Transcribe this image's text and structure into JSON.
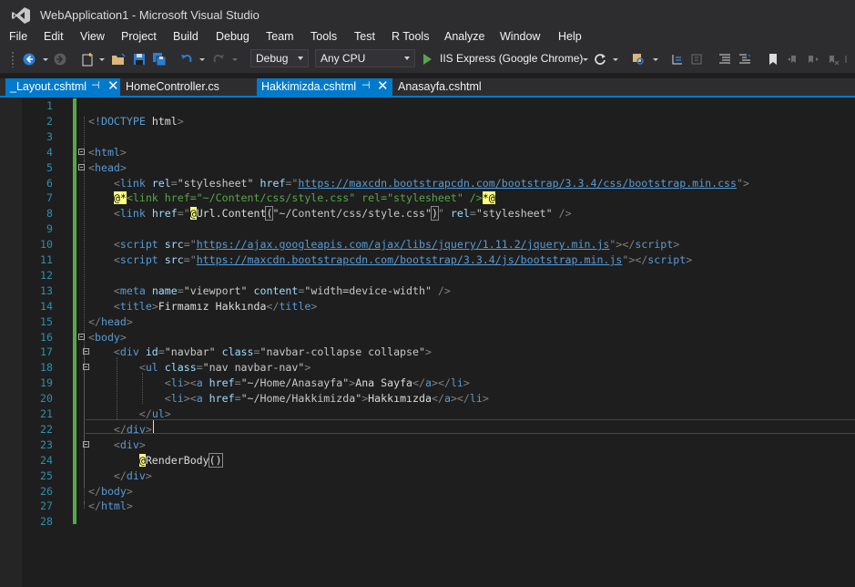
{
  "window": {
    "title": "WebApplication1 - Microsoft Visual Studio"
  },
  "menu": [
    "File",
    "Edit",
    "View",
    "Project",
    "Build",
    "Debug",
    "Team",
    "Tools",
    "Test",
    "R Tools",
    "Analyze",
    "Window",
    "Help"
  ],
  "toolbar": {
    "configuration": "Debug",
    "platform": "Any CPU",
    "start_target": "IIS Express (Google Chrome)"
  },
  "tabs": [
    {
      "label": "_Layout.cshtml",
      "active": true,
      "pinned": true
    },
    {
      "label": "HomeController.cs",
      "active": false,
      "pinned": false
    },
    {
      "label": "Hakkimizda.cshtml",
      "active": true,
      "pinned": true
    },
    {
      "label": "Anasayfa.cshtml",
      "active": false,
      "pinned": false
    }
  ],
  "editor": {
    "current_line": 22,
    "lines": [
      {
        "n": "1",
        "indent": "",
        "tokens": []
      },
      {
        "n": "2",
        "indent": "",
        "tokens": [
          [
            "t-punc",
            "<"
          ],
          [
            "t-tag",
            "!DOCTYPE "
          ],
          [
            "t-text",
            "html"
          ],
          [
            "t-punc",
            ">"
          ]
        ]
      },
      {
        "n": "3",
        "indent": "",
        "tokens": []
      },
      {
        "n": "4",
        "indent": "",
        "fold": true,
        "tokens": [
          [
            "t-punc",
            "<"
          ],
          [
            "t-tag",
            "html"
          ],
          [
            "t-punc",
            ">"
          ]
        ]
      },
      {
        "n": "5",
        "indent": "",
        "fold": true,
        "tokens": [
          [
            "t-punc",
            "<"
          ],
          [
            "t-tag",
            "head"
          ],
          [
            "t-punc",
            ">"
          ]
        ]
      },
      {
        "n": "6",
        "indent": "    ",
        "tokens": [
          [
            "t-punc",
            "<"
          ],
          [
            "t-tag",
            "link "
          ],
          [
            "t-attr",
            "rel"
          ],
          [
            "t-punc",
            "="
          ],
          [
            "t-str",
            "\"stylesheet\" "
          ],
          [
            "t-attr",
            "href"
          ],
          [
            "t-punc",
            "=\""
          ],
          [
            "t-url",
            "https://maxcdn.bootstrapcdn.com/bootstrap/3.3.4/css/bootstrap.min.css"
          ],
          [
            "t-punc",
            "\">"
          ]
        ]
      },
      {
        "n": "7",
        "indent": "    ",
        "tokens": [
          [
            "t-razor",
            "@*"
          ],
          [
            "t-comment",
            "<link href=\"~/Content/css/style.css\" rel=\"stylesheet\" />"
          ],
          [
            "t-razor",
            "*@"
          ]
        ]
      },
      {
        "n": "8",
        "indent": "    ",
        "tokens": [
          [
            "t-punc",
            "<"
          ],
          [
            "t-tag",
            "link "
          ],
          [
            "t-attr",
            "href"
          ],
          [
            "t-punc",
            "=\""
          ],
          [
            "t-razor",
            "@"
          ],
          [
            "t-method",
            "Url.Content"
          ],
          [
            "t-brace",
            "("
          ],
          [
            "t-str",
            "\"~/Content/css/style.css\""
          ],
          [
            "t-brace",
            ")"
          ],
          [
            "t-punc",
            "\" "
          ],
          [
            "t-attr",
            "rel"
          ],
          [
            "t-punc",
            "="
          ],
          [
            "t-str",
            "\"stylesheet\" "
          ],
          [
            "t-punc",
            "/>"
          ]
        ]
      },
      {
        "n": "9",
        "indent": "",
        "tokens": []
      },
      {
        "n": "10",
        "indent": "    ",
        "tokens": [
          [
            "t-punc",
            "<"
          ],
          [
            "t-tag",
            "script "
          ],
          [
            "t-attr",
            "src"
          ],
          [
            "t-punc",
            "=\""
          ],
          [
            "t-url",
            "https://ajax.googleapis.com/ajax/libs/jquery/1.11.2/jquery.min.js"
          ],
          [
            "t-punc",
            "\"></"
          ],
          [
            "t-tag",
            "script"
          ],
          [
            "t-punc",
            ">"
          ]
        ]
      },
      {
        "n": "11",
        "indent": "    ",
        "tokens": [
          [
            "t-punc",
            "<"
          ],
          [
            "t-tag",
            "script "
          ],
          [
            "t-attr",
            "src"
          ],
          [
            "t-punc",
            "=\""
          ],
          [
            "t-url",
            "https://maxcdn.bootstrapcdn.com/bootstrap/3.3.4/js/bootstrap.min.js"
          ],
          [
            "t-punc",
            "\"></"
          ],
          [
            "t-tag",
            "script"
          ],
          [
            "t-punc",
            ">"
          ]
        ]
      },
      {
        "n": "12",
        "indent": "",
        "tokens": []
      },
      {
        "n": "13",
        "indent": "    ",
        "tokens": [
          [
            "t-punc",
            "<"
          ],
          [
            "t-tag",
            "meta "
          ],
          [
            "t-attr",
            "name"
          ],
          [
            "t-punc",
            "="
          ],
          [
            "t-str",
            "\"viewport\" "
          ],
          [
            "t-attr",
            "content"
          ],
          [
            "t-punc",
            "="
          ],
          [
            "t-str",
            "\"width=device-width\" "
          ],
          [
            "t-punc",
            "/>"
          ]
        ]
      },
      {
        "n": "14",
        "indent": "    ",
        "tokens": [
          [
            "t-punc",
            "<"
          ],
          [
            "t-tag",
            "title"
          ],
          [
            "t-punc",
            ">"
          ],
          [
            "t-text",
            "Firmamız Hakkında"
          ],
          [
            "t-punc",
            "</"
          ],
          [
            "t-tag",
            "title"
          ],
          [
            "t-punc",
            ">"
          ]
        ]
      },
      {
        "n": "15",
        "indent": "",
        "tokens": [
          [
            "t-punc",
            "</"
          ],
          [
            "t-tag",
            "head"
          ],
          [
            "t-punc",
            ">"
          ]
        ]
      },
      {
        "n": "16",
        "indent": "",
        "fold": true,
        "tokens": [
          [
            "t-punc",
            "<"
          ],
          [
            "t-tag",
            "body"
          ],
          [
            "t-punc",
            ">"
          ]
        ]
      },
      {
        "n": "17",
        "indent": "    ",
        "fold": true,
        "tokens": [
          [
            "t-punc",
            "<"
          ],
          [
            "t-tag",
            "div "
          ],
          [
            "t-attr",
            "id"
          ],
          [
            "t-punc",
            "="
          ],
          [
            "t-str",
            "\"navbar\" "
          ],
          [
            "t-attr",
            "class"
          ],
          [
            "t-punc",
            "="
          ],
          [
            "t-str",
            "\"navbar-collapse collapse\""
          ],
          [
            "t-punc",
            ">"
          ]
        ]
      },
      {
        "n": "18",
        "indent": "        ",
        "fold": true,
        "tokens": [
          [
            "t-punc",
            "<"
          ],
          [
            "t-tag",
            "ul "
          ],
          [
            "t-attr",
            "class"
          ],
          [
            "t-punc",
            "="
          ],
          [
            "t-str",
            "\"nav navbar-nav\""
          ],
          [
            "t-punc",
            ">"
          ]
        ]
      },
      {
        "n": "19",
        "indent": "            ",
        "tokens": [
          [
            "t-punc",
            "<"
          ],
          [
            "t-tag",
            "li"
          ],
          [
            "t-punc",
            "><"
          ],
          [
            "t-tag",
            "a "
          ],
          [
            "t-attr",
            "href"
          ],
          [
            "t-punc",
            "="
          ],
          [
            "t-str",
            "\"~/Home/Anasayfa\""
          ],
          [
            "t-punc",
            ">"
          ],
          [
            "t-text",
            "Ana Sayfa"
          ],
          [
            "t-punc",
            "</"
          ],
          [
            "t-tag",
            "a"
          ],
          [
            "t-punc",
            "></"
          ],
          [
            "t-tag",
            "li"
          ],
          [
            "t-punc",
            ">"
          ]
        ]
      },
      {
        "n": "20",
        "indent": "            ",
        "tokens": [
          [
            "t-punc",
            "<"
          ],
          [
            "t-tag",
            "li"
          ],
          [
            "t-punc",
            "><"
          ],
          [
            "t-tag",
            "a "
          ],
          [
            "t-attr",
            "href"
          ],
          [
            "t-punc",
            "="
          ],
          [
            "t-str",
            "\"~/Home/Hakkimizda\""
          ],
          [
            "t-punc",
            ">"
          ],
          [
            "t-text",
            "Hakkımızda"
          ],
          [
            "t-punc",
            "</"
          ],
          [
            "t-tag",
            "a"
          ],
          [
            "t-punc",
            "></"
          ],
          [
            "t-tag",
            "li"
          ],
          [
            "t-punc",
            ">"
          ]
        ]
      },
      {
        "n": "21",
        "indent": "        ",
        "tokens": [
          [
            "t-punc",
            "</"
          ],
          [
            "t-tag",
            "ul"
          ],
          [
            "t-punc",
            ">"
          ]
        ]
      },
      {
        "n": "22",
        "indent": "    ",
        "tokens": [
          [
            "t-punc",
            "</"
          ],
          [
            "t-tag",
            "div"
          ],
          [
            "t-punc",
            ">"
          ]
        ]
      },
      {
        "n": "23",
        "indent": "    ",
        "fold": true,
        "tokens": [
          [
            "t-punc",
            "<"
          ],
          [
            "t-tag",
            "div"
          ],
          [
            "t-punc",
            ">"
          ]
        ]
      },
      {
        "n": "24",
        "indent": "        ",
        "tokens": [
          [
            "t-razor",
            "@"
          ],
          [
            "t-method",
            "RenderBody"
          ],
          [
            "t-brace",
            "()"
          ]
        ]
      },
      {
        "n": "25",
        "indent": "    ",
        "tokens": [
          [
            "t-punc",
            "</"
          ],
          [
            "t-tag",
            "div"
          ],
          [
            "t-punc",
            ">"
          ]
        ]
      },
      {
        "n": "26",
        "indent": "",
        "tokens": [
          [
            "t-punc",
            "</"
          ],
          [
            "t-tag",
            "body"
          ],
          [
            "t-punc",
            ">"
          ]
        ]
      },
      {
        "n": "27",
        "indent": "",
        "tokens": [
          [
            "t-punc",
            "</"
          ],
          [
            "t-tag",
            "html"
          ],
          [
            "t-punc",
            ">"
          ]
        ]
      },
      {
        "n": "28",
        "indent": "",
        "tokens": []
      }
    ]
  },
  "colors": {
    "accent": "#007acc",
    "chrome": "#2d2d30",
    "editor_bg": "#1e1e1e",
    "line_number": "#2b91af",
    "change_bar": "#57a64a"
  }
}
